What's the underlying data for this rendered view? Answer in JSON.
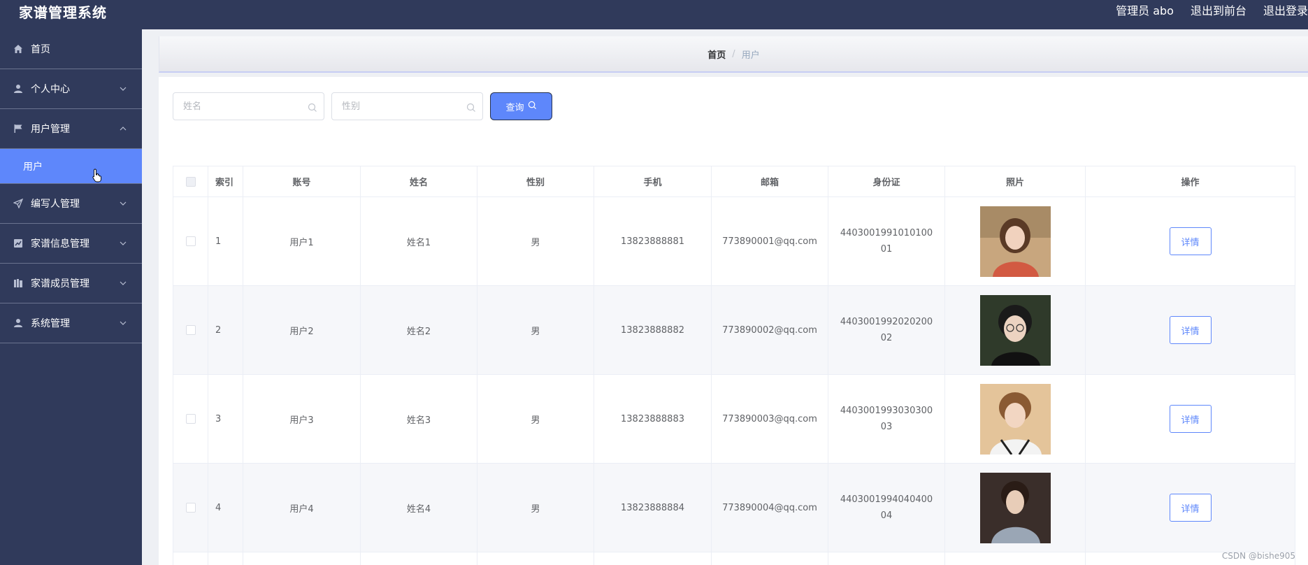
{
  "header": {
    "title": "家谱管理系统",
    "admin_label": "管理员 abo",
    "exit_front": "退出到前台",
    "logout": "退出登录"
  },
  "sidebar": {
    "items": [
      {
        "label": "首页",
        "icon": "home-icon"
      },
      {
        "label": "个人中心",
        "icon": "user-icon"
      },
      {
        "label": "用户管理",
        "icon": "flag-icon",
        "expanded": true
      },
      {
        "label": "编写人管理",
        "icon": "send-icon"
      },
      {
        "label": "家谱信息管理",
        "icon": "chart-icon"
      },
      {
        "label": "家谱成员管理",
        "icon": "book-icon"
      },
      {
        "label": "系统管理",
        "icon": "user-icon"
      }
    ],
    "sub_item": {
      "label": "用户"
    }
  },
  "breadcrumb": {
    "home": "首页",
    "separator": "/",
    "current": "用户"
  },
  "search": {
    "name_placeholder": "姓名",
    "gender_placeholder": "性别",
    "query_label": "查询"
  },
  "table": {
    "columns": [
      "索引",
      "账号",
      "姓名",
      "性别",
      "手机",
      "邮箱",
      "身份证",
      "照片",
      "操作"
    ],
    "rows": [
      {
        "index": "1",
        "account": "用户1",
        "name": "姓名1",
        "gender": "男",
        "phone": "13823888881",
        "email": "773890001@qq.com",
        "idcard": "440300199101010001",
        "action": "详情"
      },
      {
        "index": "2",
        "account": "用户2",
        "name": "姓名2",
        "gender": "男",
        "phone": "13823888882",
        "email": "773890002@qq.com",
        "idcard": "440300199202020002",
        "action": "详情"
      },
      {
        "index": "3",
        "account": "用户3",
        "name": "姓名3",
        "gender": "男",
        "phone": "13823888883",
        "email": "773890003@qq.com",
        "idcard": "440300199303030003",
        "action": "详情"
      },
      {
        "index": "4",
        "account": "用户4",
        "name": "姓名4",
        "gender": "男",
        "phone": "13823888884",
        "email": "773890004@qq.com",
        "idcard": "440300199404040004",
        "action": "详情"
      }
    ]
  },
  "watermark": "CSDN @bishe905",
  "colors": {
    "sidebar_bg": "#303a5b",
    "accent": "#5e87fb"
  }
}
